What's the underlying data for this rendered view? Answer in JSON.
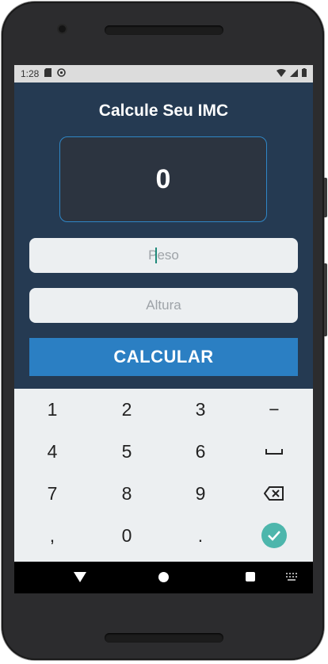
{
  "status_bar": {
    "time": "1:28"
  },
  "app": {
    "title": "Calcule Seu IMC",
    "result": "0",
    "peso_placeholder": "Peso",
    "altura_placeholder": "Altura",
    "button_label": "CALCULAR"
  },
  "keyboard": {
    "keys": [
      "1",
      "2",
      "3",
      "−",
      "4",
      "5",
      "6",
      "␣",
      "7",
      "8",
      "9",
      "⌫",
      ",",
      "0",
      ".",
      "✓"
    ],
    "accent_color": "#4db6ac"
  },
  "colors": {
    "background": "#253a52",
    "button": "#2b7fc3",
    "result_border": "#2f86c6"
  }
}
